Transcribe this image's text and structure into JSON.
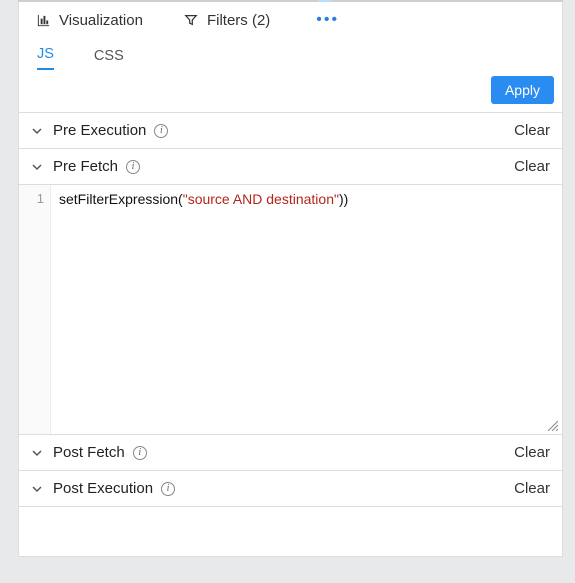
{
  "tabs": {
    "visualization": "Visualization",
    "filters": "Filters (2)"
  },
  "subtabs": {
    "js": "JS",
    "css": "CSS"
  },
  "buttons": {
    "apply": "Apply"
  },
  "sections": {
    "preExecution": {
      "title": "Pre Execution",
      "clear": "Clear"
    },
    "preFetch": {
      "title": "Pre Fetch",
      "clear": "Clear"
    },
    "postFetch": {
      "title": "Post Fetch",
      "clear": "Clear"
    },
    "postExecution": {
      "title": "Post Execution",
      "clear": "Clear"
    }
  },
  "editor": {
    "lineNumbers": [
      "1"
    ],
    "code": {
      "fn": "setFilterExpression",
      "open": "(",
      "string": "\"source AND destination\"",
      "close": "))"
    }
  }
}
